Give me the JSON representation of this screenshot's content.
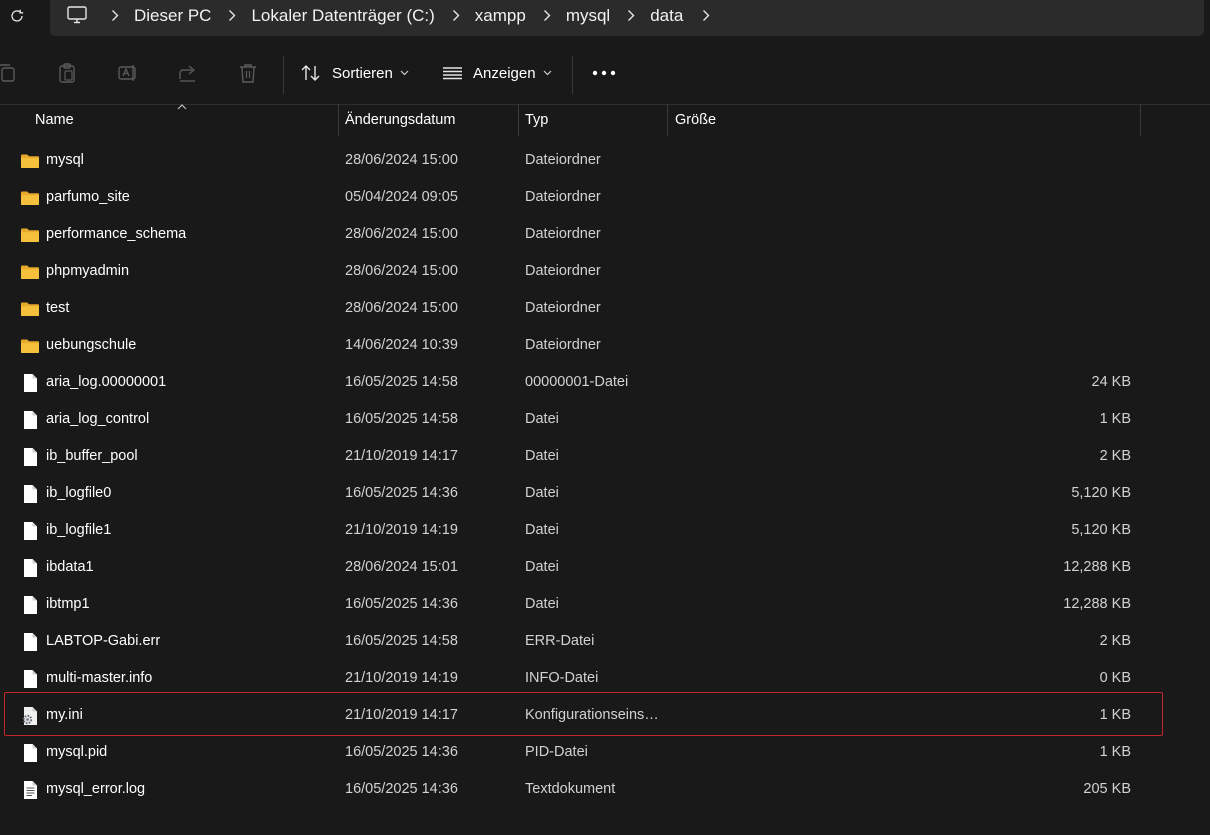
{
  "address_bar": {
    "crumbs": [
      "Dieser PC",
      "Lokaler Datenträger (C:)",
      "xampp",
      "mysql",
      "data"
    ]
  },
  "toolbar": {
    "sort_label": "Sortieren",
    "view_label": "Anzeigen"
  },
  "columns": {
    "name": "Name",
    "date": "Änderungsdatum",
    "type": "Typ",
    "size": "Größe"
  },
  "files": [
    {
      "name": "mysql",
      "date": "28/06/2024 15:00",
      "type": "Dateiordner",
      "size": "",
      "kind": "folder"
    },
    {
      "name": "parfumo_site",
      "date": "05/04/2024 09:05",
      "type": "Dateiordner",
      "size": "",
      "kind": "folder"
    },
    {
      "name": "performance_schema",
      "date": "28/06/2024 15:00",
      "type": "Dateiordner",
      "size": "",
      "kind": "folder"
    },
    {
      "name": "phpmyadmin",
      "date": "28/06/2024 15:00",
      "type": "Dateiordner",
      "size": "",
      "kind": "folder"
    },
    {
      "name": "test",
      "date": "28/06/2024 15:00",
      "type": "Dateiordner",
      "size": "",
      "kind": "folder"
    },
    {
      "name": "uebungschule",
      "date": "14/06/2024 10:39",
      "type": "Dateiordner",
      "size": "",
      "kind": "folder"
    },
    {
      "name": "aria_log.00000001",
      "date": "16/05/2025 14:58",
      "type": "00000001-Datei",
      "size": "24 KB",
      "kind": "file"
    },
    {
      "name": "aria_log_control",
      "date": "16/05/2025 14:58",
      "type": "Datei",
      "size": "1 KB",
      "kind": "file"
    },
    {
      "name": "ib_buffer_pool",
      "date": "21/10/2019 14:17",
      "type": "Datei",
      "size": "2 KB",
      "kind": "file"
    },
    {
      "name": "ib_logfile0",
      "date": "16/05/2025 14:36",
      "type": "Datei",
      "size": "5,120 KB",
      "kind": "file"
    },
    {
      "name": "ib_logfile1",
      "date": "21/10/2019 14:19",
      "type": "Datei",
      "size": "5,120 KB",
      "kind": "file"
    },
    {
      "name": "ibdata1",
      "date": "28/06/2024 15:01",
      "type": "Datei",
      "size": "12,288 KB",
      "kind": "file"
    },
    {
      "name": "ibtmp1",
      "date": "16/05/2025 14:36",
      "type": "Datei",
      "size": "12,288 KB",
      "kind": "file"
    },
    {
      "name": "LABTOP-Gabi.err",
      "date": "16/05/2025 14:58",
      "type": "ERR-Datei",
      "size": "2 KB",
      "kind": "file"
    },
    {
      "name": "multi-master.info",
      "date": "21/10/2019 14:19",
      "type": "INFO-Datei",
      "size": "0 KB",
      "kind": "file"
    },
    {
      "name": "my.ini",
      "date": "21/10/2019 14:17",
      "type": "Konfigurationseins…",
      "size": "1 KB",
      "kind": "config",
      "highlighted": true
    },
    {
      "name": "mysql.pid",
      "date": "16/05/2025 14:36",
      "type": "PID-Datei",
      "size": "1 KB",
      "kind": "file"
    },
    {
      "name": "mysql_error.log",
      "date": "16/05/2025 14:36",
      "type": "Textdokument",
      "size": "205 KB",
      "kind": "text"
    }
  ],
  "colors": {
    "background": "#191919",
    "address_bar": "#2b2b2b",
    "folder": "#f5c13d",
    "highlight_border": "#c0272d"
  }
}
